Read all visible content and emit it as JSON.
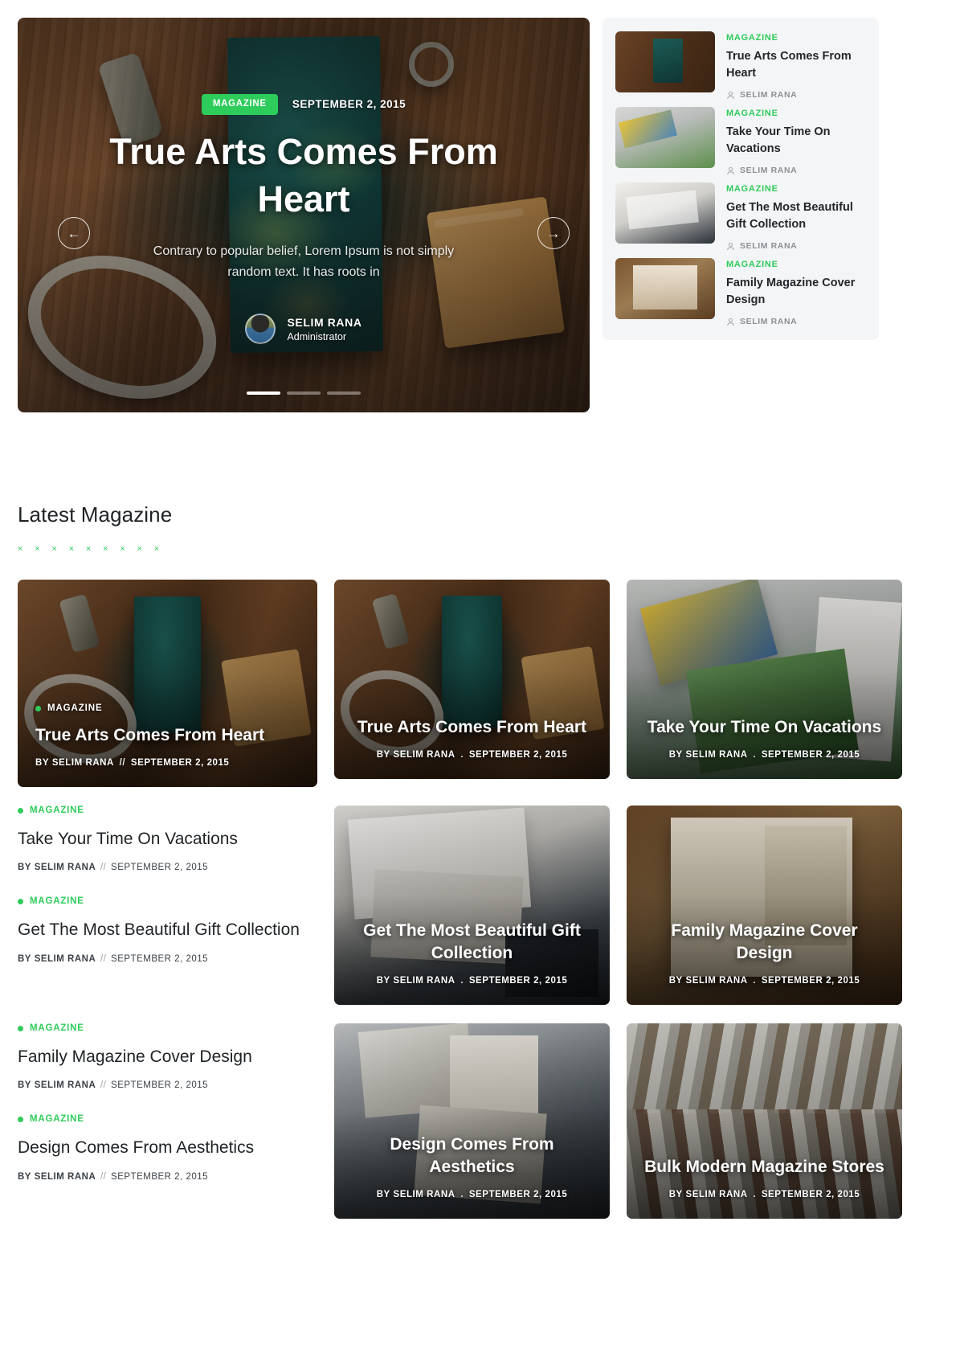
{
  "theme": {
    "accent": "#2ecc5a",
    "text": "#1f2326",
    "muted": "#8b9197",
    "sidebar_bg": "#f4f5f6"
  },
  "hero": {
    "badge": "MAGAZINE",
    "date": "SEPTEMBER 2, 2015",
    "title": "True Arts Comes From Heart",
    "excerpt": "Contrary to popular belief, Lorem Ipsum is not simply random text. It has roots in",
    "author_name": "SELIM RANA",
    "author_role": "Administrator",
    "prev_icon": "arrow-left-icon",
    "next_icon": "arrow-right-icon",
    "slide_count": 3,
    "active_slide": 1
  },
  "sidebar": {
    "items": [
      {
        "category": "MAGAZINE",
        "title": "True Arts Comes From Heart",
        "author": "SELIM RANA",
        "thumb": "waves-magazine-on-wood"
      },
      {
        "category": "MAGAZINE",
        "title": "Take Your Time On Vacations",
        "author": "SELIM RANA",
        "thumb": "open-travel-magazines"
      },
      {
        "category": "MAGAZINE",
        "title": "Get The Most Beautiful Gift Collection",
        "author": "SELIM RANA",
        "thumb": "hands-holding-open-magazine"
      },
      {
        "category": "MAGAZINE",
        "title": "Family Magazine Cover Design",
        "author": "SELIM RANA",
        "thumb": "culture-book-spread"
      }
    ]
  },
  "latest": {
    "heading": "Latest Magazine",
    "decoration": "× × × × × × × × ×",
    "feature": {
      "category": "MAGAZINE",
      "title": "True Arts Comes From Heart",
      "by_label": "BY",
      "author": "SELIM RANA",
      "separator": "//",
      "date": "SEPTEMBER 2, 2015"
    },
    "cards": [
      {
        "title": "True Arts Comes From Heart",
        "by_label": "BY",
        "author": "SELIM RANA",
        "separator": ".",
        "date": "SEPTEMBER 2, 2015",
        "image": "waves-magazine-on-wood"
      },
      {
        "title": "Take Your Time On Vacations",
        "by_label": "BY",
        "author": "SELIM RANA",
        "separator": ".",
        "date": "SEPTEMBER 2, 2015",
        "image": "open-travel-magazines"
      },
      {
        "title": "Get The Most Beautiful Gift Collection",
        "by_label": "BY",
        "author": "SELIM RANA",
        "separator": ".",
        "date": "SEPTEMBER 2, 2015",
        "image": "magazine-spread-on-table"
      },
      {
        "title": "Family Magazine Cover Design",
        "by_label": "BY",
        "author": "SELIM RANA",
        "separator": ".",
        "date": "SEPTEMBER 2, 2015",
        "image": "culture-book-spread"
      },
      {
        "title": "Design Comes From Aesthetics",
        "by_label": "BY",
        "author": "SELIM RANA",
        "separator": ".",
        "date": "SEPTEMBER 2, 2015",
        "image": "stack-of-fashion-magazines"
      },
      {
        "title": "Bulk Modern Magazine Stores",
        "by_label": "BY",
        "author": "SELIM RANA",
        "separator": ".",
        "date": "SEPTEMBER 2, 2015",
        "image": "magazine-store-rack"
      }
    ],
    "posts": [
      {
        "category": "MAGAZINE",
        "title": "Take Your Time On Vacations",
        "by_label": "BY",
        "author": "SELIM RANA",
        "separator": "//",
        "date": "SEPTEMBER 2, 2015"
      },
      {
        "category": "MAGAZINE",
        "title": "Get The Most Beautiful Gift Collection",
        "by_label": "BY",
        "author": "SELIM RANA",
        "separator": "//",
        "date": "SEPTEMBER 2, 2015"
      },
      {
        "category": "MAGAZINE",
        "title": "Family Magazine Cover Design",
        "by_label": "BY",
        "author": "SELIM RANA",
        "separator": "//",
        "date": "SEPTEMBER 2, 2015"
      },
      {
        "category": "MAGAZINE",
        "title": "Design Comes From Aesthetics",
        "by_label": "BY",
        "author": "SELIM RANA",
        "separator": "//",
        "date": "SEPTEMBER 2, 2015"
      }
    ]
  }
}
